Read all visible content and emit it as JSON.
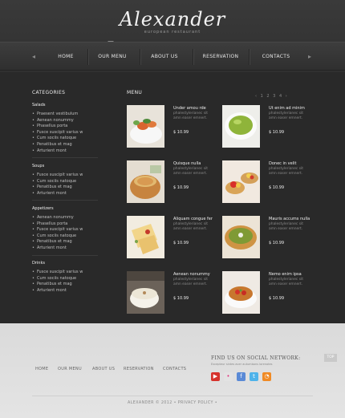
{
  "header": {
    "logo": "Alexander",
    "tagline": "european restaurant"
  },
  "nav": {
    "items": [
      {
        "label": "HOME"
      },
      {
        "label": "OUR MENU"
      },
      {
        "label": "ABOUT US"
      },
      {
        "label": "RESERVATION"
      },
      {
        "label": "CONTACTS"
      }
    ],
    "left_arrow": "◂",
    "right_arrow": "▸"
  },
  "categories": {
    "title": "CATEGORIES",
    "groups": [
      {
        "name": "Salads",
        "items": [
          "Praesent vestibulum",
          "Aenean nonummy",
          "Phasellus porta",
          "Fusce suscipit varius w",
          "Cum sociis natoque",
          "Penatibus et mag",
          "Arturient mont"
        ]
      },
      {
        "name": "Soups",
        "items": [
          "Fusce suscipit varius w",
          "Cum sociis natoque",
          "Penatibus et mag",
          "Arturient mont"
        ]
      },
      {
        "name": "Appetizers",
        "items": [
          "Aenean nonummy",
          "Phasellus porta",
          "Fusce suscipit varius w",
          "Cum sociis natoque",
          "Penatibus et mag",
          "Arturient mont"
        ]
      },
      {
        "name": "Drinks",
        "items": [
          "Fusce suscipit varius w",
          "Cum sociis natoque",
          "Penatibus et mag",
          "Arturient mont"
        ]
      }
    ]
  },
  "menu": {
    "title": "MENU",
    "pager": {
      "prev": "‹",
      "pages": [
        "1",
        "2",
        "3",
        "4"
      ],
      "next": "›"
    },
    "dishes": [
      {
        "name": "Under amou rde",
        "desc": "phalestylerianec sit amn easer emnert.",
        "price": "$ 10.99",
        "photo": "shrimp"
      },
      {
        "name": "Ut enim ad minim",
        "desc": "phalestylerianec sit amn easer emnert.",
        "price": "$ 10.99",
        "photo": "green-soup"
      },
      {
        "name": "Quisque nulla",
        "desc": "phalestylerianec sit amn easer emnert.",
        "price": "$ 10.99",
        "photo": "bread-bowl"
      },
      {
        "name": "Donec in velit",
        "desc": "phalestylerianec sit amn easer emnert.",
        "price": "$ 10.99",
        "photo": "tartlets"
      },
      {
        "name": "Aliquam congue fer",
        "desc": "phalestylerianec sit amn easer emnert.",
        "price": "$ 10.99",
        "photo": "crepes"
      },
      {
        "name": "Mauris accums nulla",
        "desc": "phalestylerianec sit amn easer emnert.",
        "price": "$ 10.99",
        "photo": "pea-soup"
      },
      {
        "name": "Aenean nonummy",
        "desc": "phalestylerianec sit amn easer emnert.",
        "price": "$ 10.99",
        "photo": "cream-soup"
      },
      {
        "name": "Nemo enim ipsa",
        "desc": "phalestylerianec sit amn easer emnert.",
        "price": "$ 10.99",
        "photo": "bruschetta"
      }
    ]
  },
  "footer": {
    "links": [
      "HOME",
      "OUR MENU",
      "ABOUT US",
      "RESERVATION",
      "CONTACTS"
    ],
    "social_title": "FIND US ON SOCIAL NETWORK:",
    "social_sub": "Excepteur sintes aver autumbons lorenotes",
    "social_icons": [
      {
        "name": "youtube-icon",
        "glyph": "▶",
        "color": "#d6322c"
      },
      {
        "name": "flickr-icon",
        "glyph": "•",
        "color": "#e3e3e3"
      },
      {
        "name": "facebook-icon",
        "glyph": "f",
        "color": "#5a8ad6"
      },
      {
        "name": "twitter-icon",
        "glyph": "t",
        "color": "#4fb3ea"
      },
      {
        "name": "rss-icon",
        "glyph": "◔",
        "color": "#f08a24"
      }
    ],
    "top_button": "TOP",
    "copyright": "ALEXANDER © 2012 • PRIVACY POLICY •"
  }
}
